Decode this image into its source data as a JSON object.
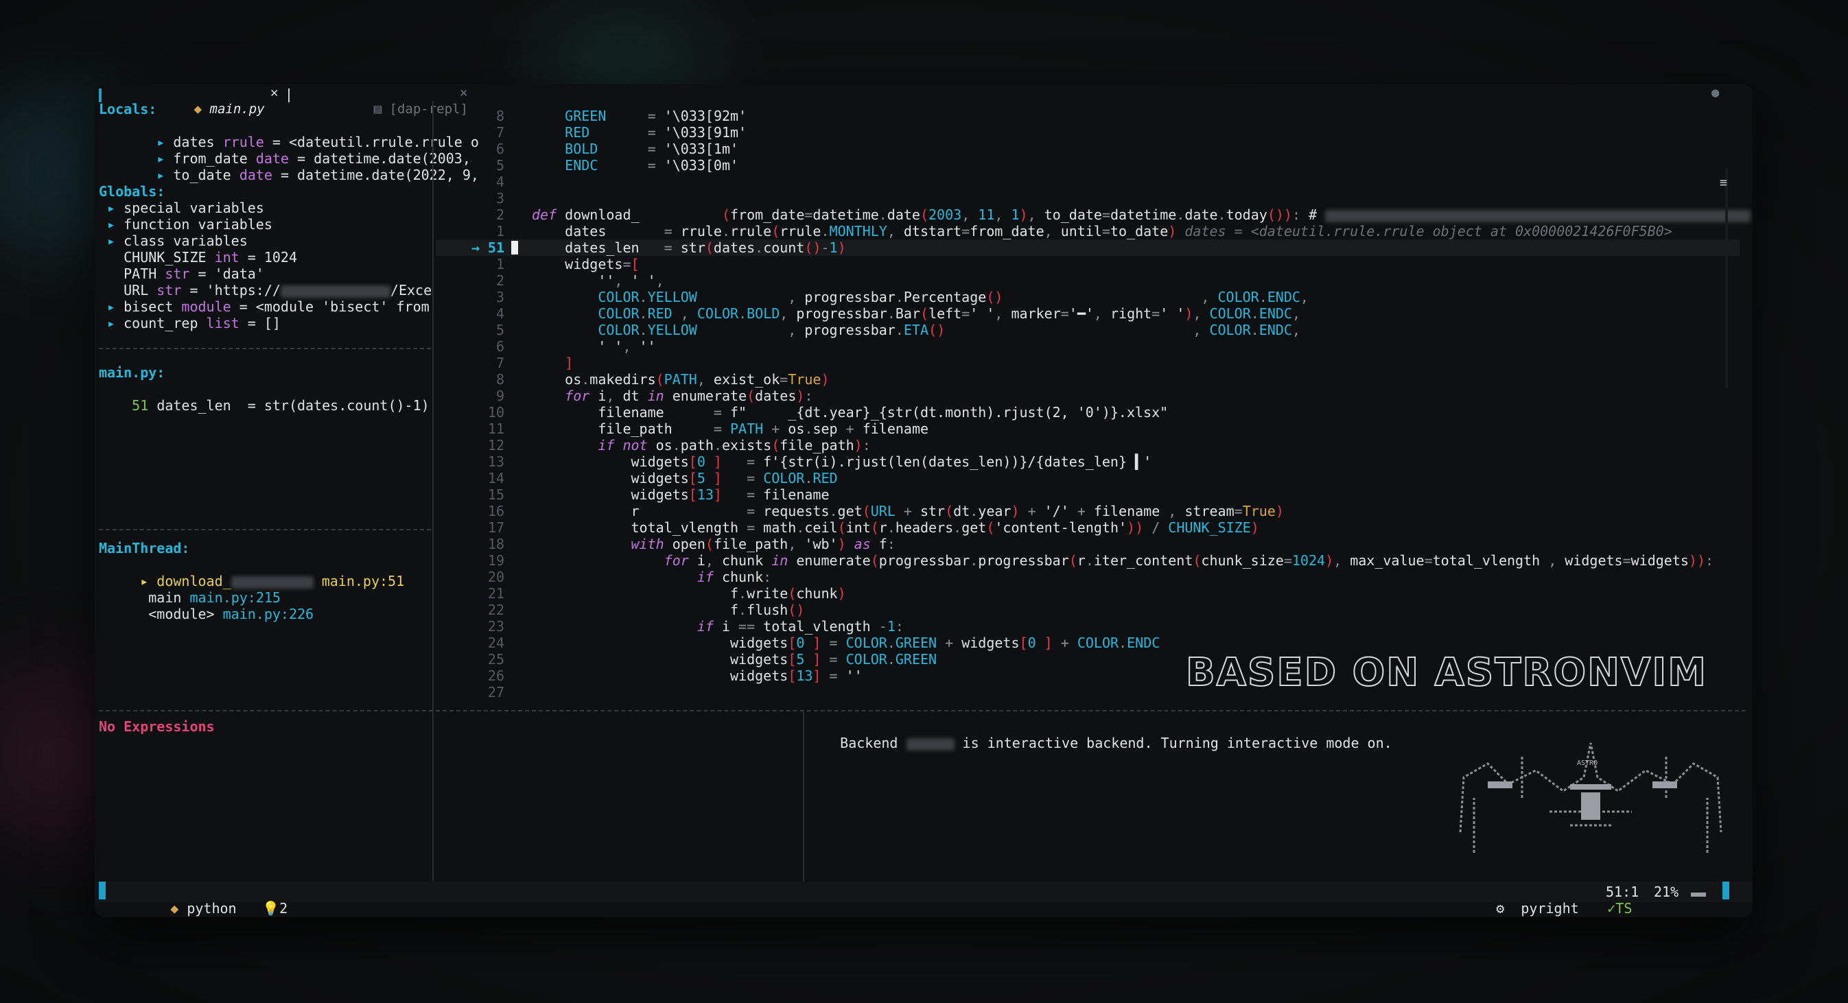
{
  "tabs": [
    {
      "icon": "python-icon",
      "label": "main.py",
      "active": true,
      "close": "✕"
    },
    {
      "icon": "file-icon",
      "label": "[dap-repl]",
      "active": false,
      "close": "✕"
    }
  ],
  "locals": {
    "header": "Locals:",
    "items": [
      {
        "name": "dates",
        "type": "rrule",
        "value": "= <dateutil.rrule.rrule o"
      },
      {
        "name": "from_date",
        "type": "date",
        "value": "= datetime.date(2003,"
      },
      {
        "name": "to_date",
        "type": "date",
        "value": "= datetime.date(2022, 9,"
      }
    ]
  },
  "globals": {
    "header": "Globals:",
    "groups": [
      "special variables",
      "function variables",
      "class variables"
    ],
    "vars": [
      {
        "name": "CHUNK_SIZE",
        "type": "int",
        "value": "= 1024"
      },
      {
        "name": "PATH",
        "type": "str",
        "value": "= 'data'"
      },
      {
        "name": "URL",
        "type": "str",
        "value_pre": "= 'https://",
        "value_post": "/Exce"
      }
    ],
    "modules": [
      {
        "name": "bisect",
        "type": "module",
        "value": "= <module 'bisect' from"
      },
      {
        "name": "count_rep",
        "type": "list",
        "value": "= []"
      }
    ]
  },
  "breakpoints": {
    "file": "main.py:",
    "line_no": "51",
    "code": "dates_len  = str(dates.count()-1)"
  },
  "stack": {
    "thread": "MainThread:",
    "frames": [
      {
        "name": "download_",
        "loc": "main.py:51"
      },
      {
        "name": "main",
        "loc": "main.py:215"
      },
      {
        "name": "<module>",
        "loc": "main.py:226"
      }
    ]
  },
  "expressions": "No Expressions",
  "repl": {
    "pre": "Backend ",
    "post": " is interactive backend. Turning interactive mode on."
  },
  "code": {
    "lines": [
      {
        "n": "8",
        "t": "    GREEN     = '\\033[92m'"
      },
      {
        "n": "7",
        "t": "    RED       = '\\033[91m'"
      },
      {
        "n": "6",
        "t": "    BOLD      = '\\033[1m'"
      },
      {
        "n": "5",
        "t": "    ENDC      = '\\033[0m'"
      },
      {
        "n": "4",
        "t": ""
      },
      {
        "n": "3",
        "t": ""
      },
      {
        "n": "2",
        "t": "def download_          (from_date=datetime.date(2003, 11, 1), to_date=datetime.date.today()): #"
      },
      {
        "n": "1",
        "t": "    dates       = rrule.rrule(rrule.MONTHLY, dtstart=from_date, until=to_date) dates = <dateutil.rrule.rrule object at 0x0000021426F0F5B0>"
      },
      {
        "n": "51",
        "t": "    dates_len   = str(dates.count()-1)",
        "current": true
      },
      {
        "n": "1",
        "t": "    widgets=["
      },
      {
        "n": "2",
        "t": "        '', ' ',"
      },
      {
        "n": "3",
        "t": "        COLOR.YELLOW           , progressbar.Percentage()                        , COLOR.ENDC,"
      },
      {
        "n": "4",
        "t": "        COLOR.RED , COLOR.BOLD, progressbar.Bar(left=' ', marker='━', right=' '), COLOR.ENDC,"
      },
      {
        "n": "5",
        "t": "        COLOR.YELLOW           , progressbar.ETA()                              , COLOR.ENDC,"
      },
      {
        "n": "6",
        "t": "        ' ', ''"
      },
      {
        "n": "7",
        "t": "    ]"
      },
      {
        "n": "8",
        "t": "    os.makedirs(PATH, exist_ok=True)"
      },
      {
        "n": "9",
        "t": "    for i, dt in enumerate(dates):"
      },
      {
        "n": "10",
        "t": "        filename      = f\"     _{dt.year}_{str(dt.month).rjust(2, '0')}.xlsx\""
      },
      {
        "n": "11",
        "t": "        file_path     = PATH + os.sep + filename"
      },
      {
        "n": "12",
        "t": "        if not os.path.exists(file_path):"
      },
      {
        "n": "13",
        "t": "            widgets[0 ]   = f'{str(i).rjust(len(dates_len))}/{dates_len} ▍'"
      },
      {
        "n": "14",
        "t": "            widgets[5 ]   = COLOR.RED"
      },
      {
        "n": "15",
        "t": "            widgets[13]   = filename"
      },
      {
        "n": "16",
        "t": "            r             = requests.get(URL + str(dt.year) + '/' + filename , stream=True)"
      },
      {
        "n": "17",
        "t": "            total_vlength = math.ceil(int(r.headers.get('content-length')) / CHUNK_SIZE)"
      },
      {
        "n": "18",
        "t": "            with open(file_path, 'wb') as f:"
      },
      {
        "n": "19",
        "t": "                for i, chunk in enumerate(progressbar.progressbar(r.iter_content(chunk_size=1024), max_value=total_vlength , widgets=widgets)):"
      },
      {
        "n": "20",
        "t": "                    if chunk:"
      },
      {
        "n": "21",
        "t": "                        f.write(chunk)"
      },
      {
        "n": "22",
        "t": "                        f.flush()"
      },
      {
        "n": "23",
        "t": "                    if i == total_vlength -1:"
      },
      {
        "n": "24",
        "t": "                        widgets[0 ] = COLOR.GREEN + widgets[0 ] + COLOR.ENDC"
      },
      {
        "n": "25",
        "t": "                        widgets[5 ] = COLOR.GREEN"
      },
      {
        "n": "26",
        "t": "                        widgets[13] = ''"
      },
      {
        "n": "27",
        "t": ""
      }
    ],
    "inline_hint_tail": "th"
  },
  "banner": "BASED ON ASTRONVIM",
  "logo_text": "ASTRO",
  "status": {
    "mode_icon": "python-icon",
    "language": "python",
    "diag_icon": "lightbulb-icon",
    "diag_count": "2",
    "lsp_icon": "gear-icon",
    "lsp": "pyright",
    "ts": "TS",
    "position": "51:1",
    "percent": "21%"
  },
  "colors": {
    "accent": "#1ea0c8",
    "bg": "#0f1011",
    "keyword": "#c277e0",
    "string": "#e3e3e3",
    "constant": "#29b8db",
    "error": "#e5394f"
  }
}
